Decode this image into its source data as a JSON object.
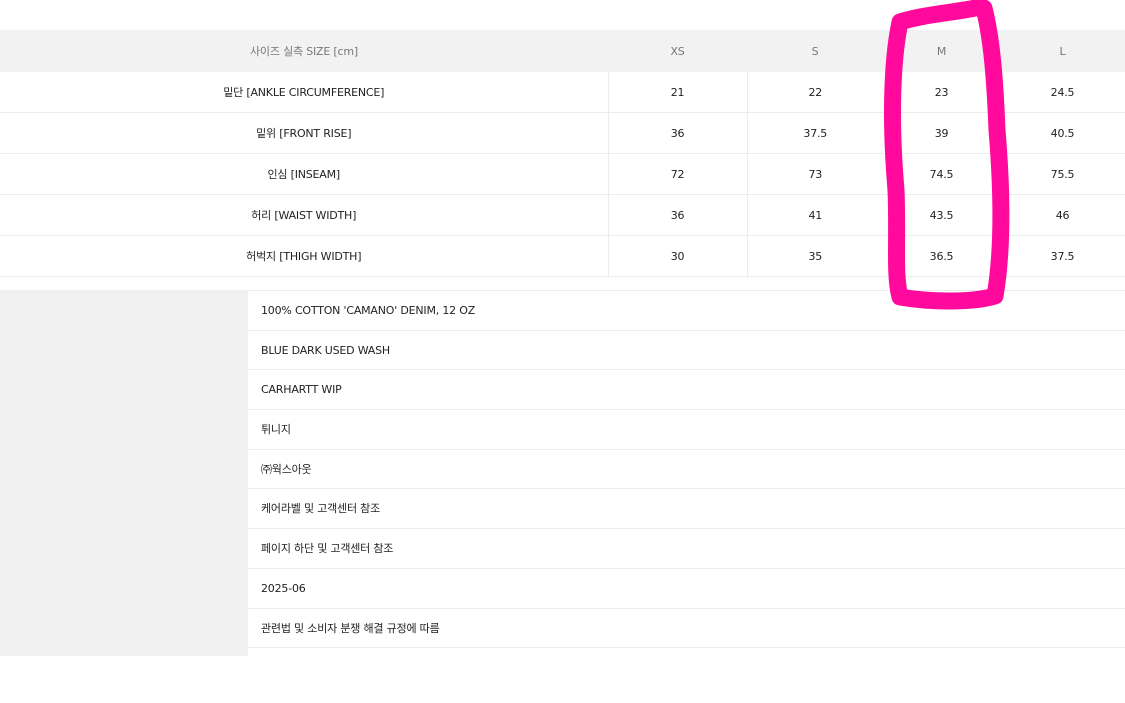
{
  "size_table": {
    "header": {
      "label": "사이즈 실측 SIZE [cm]",
      "sizes": [
        "XS",
        "S",
        "M",
        "L"
      ]
    },
    "rows": [
      {
        "label": "밑단 [ANKLE CIRCUMFERENCE]",
        "values": [
          "21",
          "22",
          "23",
          "24.5"
        ]
      },
      {
        "label": "밑위 [FRONT RISE]",
        "values": [
          "36",
          "37.5",
          "39",
          "40.5"
        ]
      },
      {
        "label": "인심 [INSEAM]",
        "values": [
          "72",
          "73",
          "74.5",
          "75.5"
        ]
      },
      {
        "label": "허리 [WAIST WIDTH]",
        "values": [
          "36",
          "41",
          "43.5",
          "46"
        ]
      },
      {
        "label": "허벅지 [THIGH WIDTH]",
        "values": [
          "30",
          "35",
          "36.5",
          "37.5"
        ]
      }
    ]
  },
  "product_info": {
    "values": [
      "100% COTTON 'CAMANO' DENIM, 12 OZ",
      "BLUE DARK USED WASH",
      "CARHARTT WIP",
      "튀니지",
      "㈜웍스아웃",
      "케어라벨 및 고객센터 참조",
      "페이지 하단 및 고객센터 참조",
      "2025-06",
      "관련법 및 소비자 분쟁 해결 규정에 따름"
    ]
  },
  "annotation": {
    "highlight_color": "#ff0a9d",
    "highlighted_size": "M"
  }
}
